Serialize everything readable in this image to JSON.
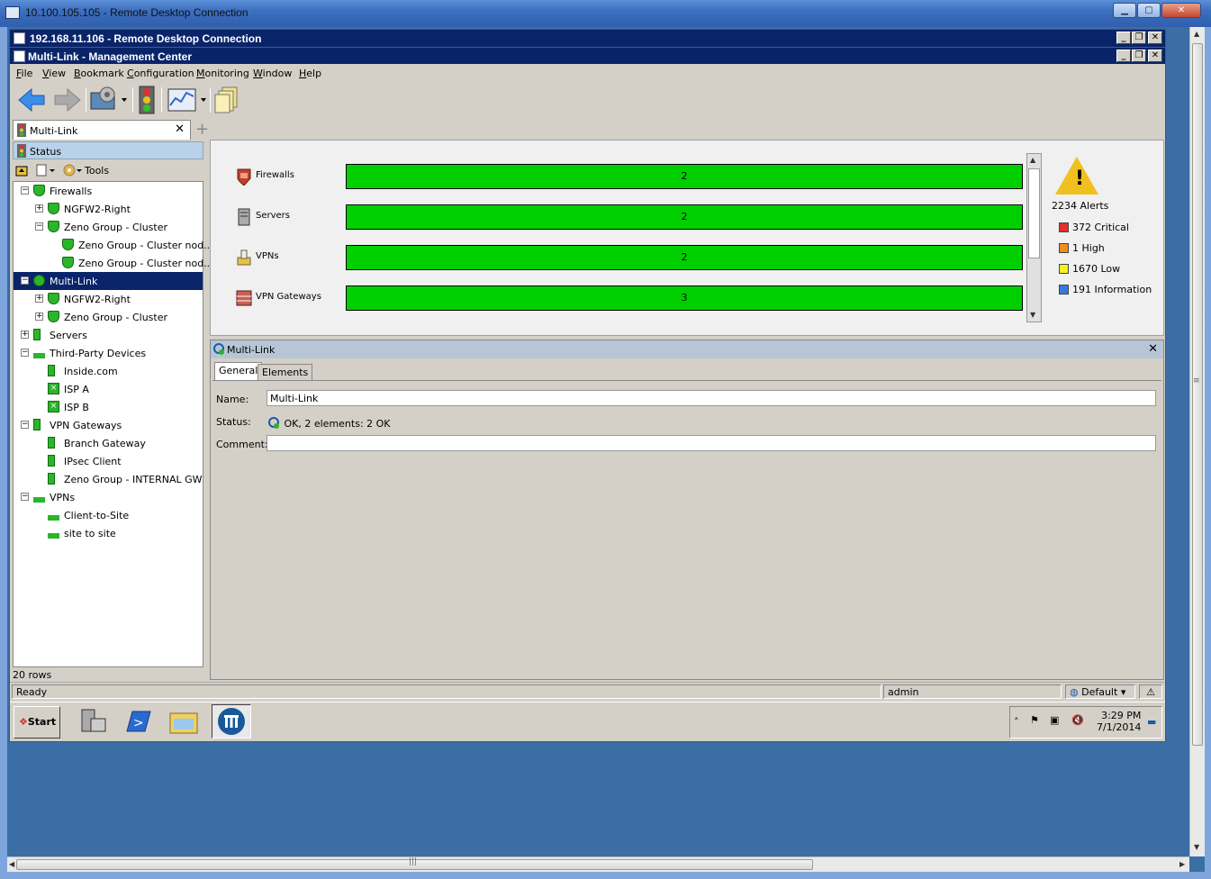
{
  "outer_window": {
    "title": "10.100.105.105 - Remote Desktop Connection"
  },
  "inner_window": {
    "title": "192.168.11.106 - Remote Desktop Connection"
  },
  "app": {
    "title": "Multi-Link - Management Center"
  },
  "menu": [
    {
      "label": "File",
      "key": "F",
      "rest": "ile"
    },
    {
      "label": "View",
      "key": "V",
      "rest": "iew"
    },
    {
      "label": "Bookmark",
      "key": "B",
      "rest": "ookmark"
    },
    {
      "label": "Configuration",
      "key": "C",
      "rest": "onfiguration"
    },
    {
      "label": "Monitoring",
      "key": "M",
      "rest": "onitoring"
    },
    {
      "label": "Window",
      "key": "W",
      "rest": "indow"
    },
    {
      "label": "Help",
      "key": "H",
      "rest": "elp"
    }
  ],
  "tab": {
    "label": "Multi-Link",
    "close": "✕",
    "add": "+"
  },
  "left": {
    "header": "Status",
    "tools_label": "Tools",
    "rows": "20 rows",
    "tree": [
      {
        "label": "Firewalls",
        "level": 0,
        "exp": "−",
        "icon": "shield"
      },
      {
        "label": "NGFW2-Right",
        "level": 1,
        "exp": "+",
        "icon": "shield"
      },
      {
        "label": "Zeno Group - Cluster",
        "level": 1,
        "exp": "−",
        "icon": "shield"
      },
      {
        "label": "Zeno Group - Cluster nod...",
        "level": 2,
        "exp": "",
        "icon": "shield"
      },
      {
        "label": "Zeno Group - Cluster nod...",
        "level": 2,
        "exp": "",
        "icon": "shield"
      },
      {
        "label": "Multi-Link",
        "level": 0,
        "exp": "−",
        "icon": "link",
        "selected": true
      },
      {
        "label": "NGFW2-Right",
        "level": 1,
        "exp": "+",
        "icon": "shield"
      },
      {
        "label": "Zeno Group - Cluster",
        "level": 1,
        "exp": "+",
        "icon": "shield"
      },
      {
        "label": "Servers",
        "level": 0,
        "exp": "+",
        "icon": "bar"
      },
      {
        "label": "Third-Party Devices",
        "level": 0,
        "exp": "−",
        "icon": "vpn"
      },
      {
        "label": "Inside.com",
        "level": 1,
        "exp": "",
        "icon": "bar"
      },
      {
        "label": "ISP A",
        "level": 1,
        "exp": "",
        "icon": "x"
      },
      {
        "label": "ISP B",
        "level": 1,
        "exp": "",
        "icon": "x"
      },
      {
        "label": "VPN Gateways",
        "level": 0,
        "exp": "−",
        "icon": "bar"
      },
      {
        "label": "Branch Gateway",
        "level": 1,
        "exp": "",
        "icon": "bar"
      },
      {
        "label": "IPsec Client",
        "level": 1,
        "exp": "",
        "icon": "bar"
      },
      {
        "label": "Zeno Group -  INTERNAL GW",
        "level": 1,
        "exp": "",
        "icon": "bar"
      },
      {
        "label": "VPNs",
        "level": 0,
        "exp": "−",
        "icon": "vpn"
      },
      {
        "label": "Client-to-Site",
        "level": 1,
        "exp": "",
        "icon": "vpn"
      },
      {
        "label": "site to site",
        "level": 1,
        "exp": "",
        "icon": "vpn"
      }
    ]
  },
  "summary": {
    "rows": [
      {
        "label": "Firewalls",
        "count": "2",
        "color": "#00d000"
      },
      {
        "label": "Servers",
        "count": "2",
        "color": "#00d000"
      },
      {
        "label": "VPNs",
        "count": "2",
        "color": "#00d000"
      },
      {
        "label": "VPN Gateways",
        "count": "3",
        "color": "#00d000"
      }
    ],
    "alerts_total": "2234 Alerts",
    "alerts": [
      {
        "label": "372 Critical",
        "color": "#e03030"
      },
      {
        "label": "1 High",
        "color": "#f08c20"
      },
      {
        "label": "1670 Low",
        "color": "#f8f020"
      },
      {
        "label": "191 Information",
        "color": "#3a78d8"
      }
    ]
  },
  "detail": {
    "header": "Multi-Link",
    "close": "✕",
    "tabs": [
      "General",
      "Elements"
    ],
    "name_label": "Name:",
    "name_value": "Multi-Link",
    "status_label": "Status:",
    "status_value": "OK, 2 elements: 2 OK",
    "comment_label": "Comment:",
    "comment_value": ""
  },
  "statusbar": {
    "ready": "Ready",
    "user": "admin",
    "profile": "Default"
  },
  "taskbar": {
    "start": "Start",
    "time": "3:29 PM",
    "date": "7/1/2014"
  }
}
